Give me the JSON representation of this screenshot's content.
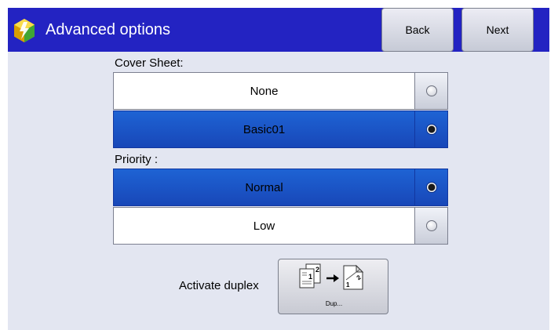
{
  "header": {
    "title": "Advanced options",
    "back_label": "Back",
    "next_label": "Next",
    "background": "#2323c2"
  },
  "cover_sheet": {
    "label": "Cover Sheet:",
    "options": [
      {
        "label": "None",
        "selected": false
      },
      {
        "label": "Basic01",
        "selected": true
      }
    ]
  },
  "priority": {
    "label": "Priority :",
    "options": [
      {
        "label": "Normal",
        "selected": true
      },
      {
        "label": "Low",
        "selected": false
      }
    ]
  },
  "duplex": {
    "label": "Activate duplex",
    "button_caption": "Dup...",
    "icon": "duplex-pages-icon",
    "page_numbers": [
      "1",
      "2"
    ]
  },
  "colors": {
    "selected": "#1e63d4",
    "panel": "#e3e6f1"
  }
}
